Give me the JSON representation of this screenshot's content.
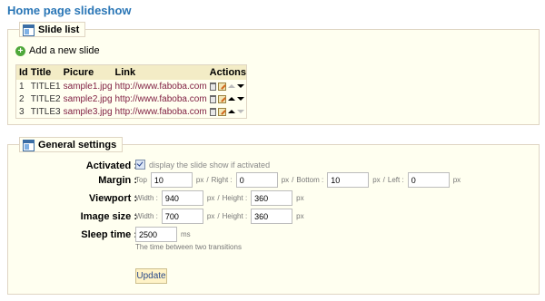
{
  "page": {
    "title": "Home page slideshow"
  },
  "slide_list": {
    "legend": "Slide list",
    "add_label": "Add a new slide",
    "columns": [
      "Id",
      "Title",
      "Picure",
      "Link",
      "Actions"
    ],
    "rows": [
      {
        "id": "1",
        "title": "TITLE1",
        "picture": "sample1.jpg",
        "link": "http://www.faboba.com",
        "up_enabled": false,
        "down_enabled": true
      },
      {
        "id": "2",
        "title": "TITLE2",
        "picture": "sample2.jpg",
        "link": "http://www.faboba.com",
        "up_enabled": true,
        "down_enabled": true
      },
      {
        "id": "3",
        "title": "TITLE3",
        "picture": "sample3.jpg",
        "link": "http://www.faboba.com",
        "up_enabled": true,
        "down_enabled": false
      }
    ]
  },
  "general_settings": {
    "legend": "General settings",
    "activated": {
      "label": "Activated :",
      "checked": true,
      "text": "display the slide show if activated"
    },
    "margin": {
      "label": "Margin :",
      "unit": "px",
      "top": {
        "label": "Top",
        "value": "10"
      },
      "right": {
        "label": "Right :",
        "value": "0"
      },
      "bottom": {
        "label": "Bottom :",
        "value": "10"
      },
      "left": {
        "label": "Left :",
        "value": "0"
      }
    },
    "viewport": {
      "label": "Viewport :",
      "unit": "px",
      "width": {
        "label": "Width :",
        "value": "940"
      },
      "height": {
        "label": "Height :",
        "value": "360"
      }
    },
    "image_size": {
      "label": "Image size :",
      "unit": "px",
      "width": {
        "label": "Width :",
        "value": "700"
      },
      "height": {
        "label": "Height :",
        "value": "360"
      }
    },
    "sleep_time": {
      "label": "Sleep time :",
      "value": "2500",
      "unit": "ms",
      "hint": "The time between two transitions"
    },
    "separator": "/",
    "update_label": "Update"
  },
  "icons": {
    "legend": "legend-window-icon",
    "add": "plus-circle-icon",
    "delete": "trash-icon",
    "edit": "edit-icon",
    "up": "arrow-up-icon",
    "down": "arrow-down-icon"
  },
  "colors": {
    "title": "#2a76b6",
    "panel_bg": "#fffff0",
    "panel_border": "#dfd5c3",
    "table_header": "#f3ecc6",
    "link": "#812143"
  }
}
